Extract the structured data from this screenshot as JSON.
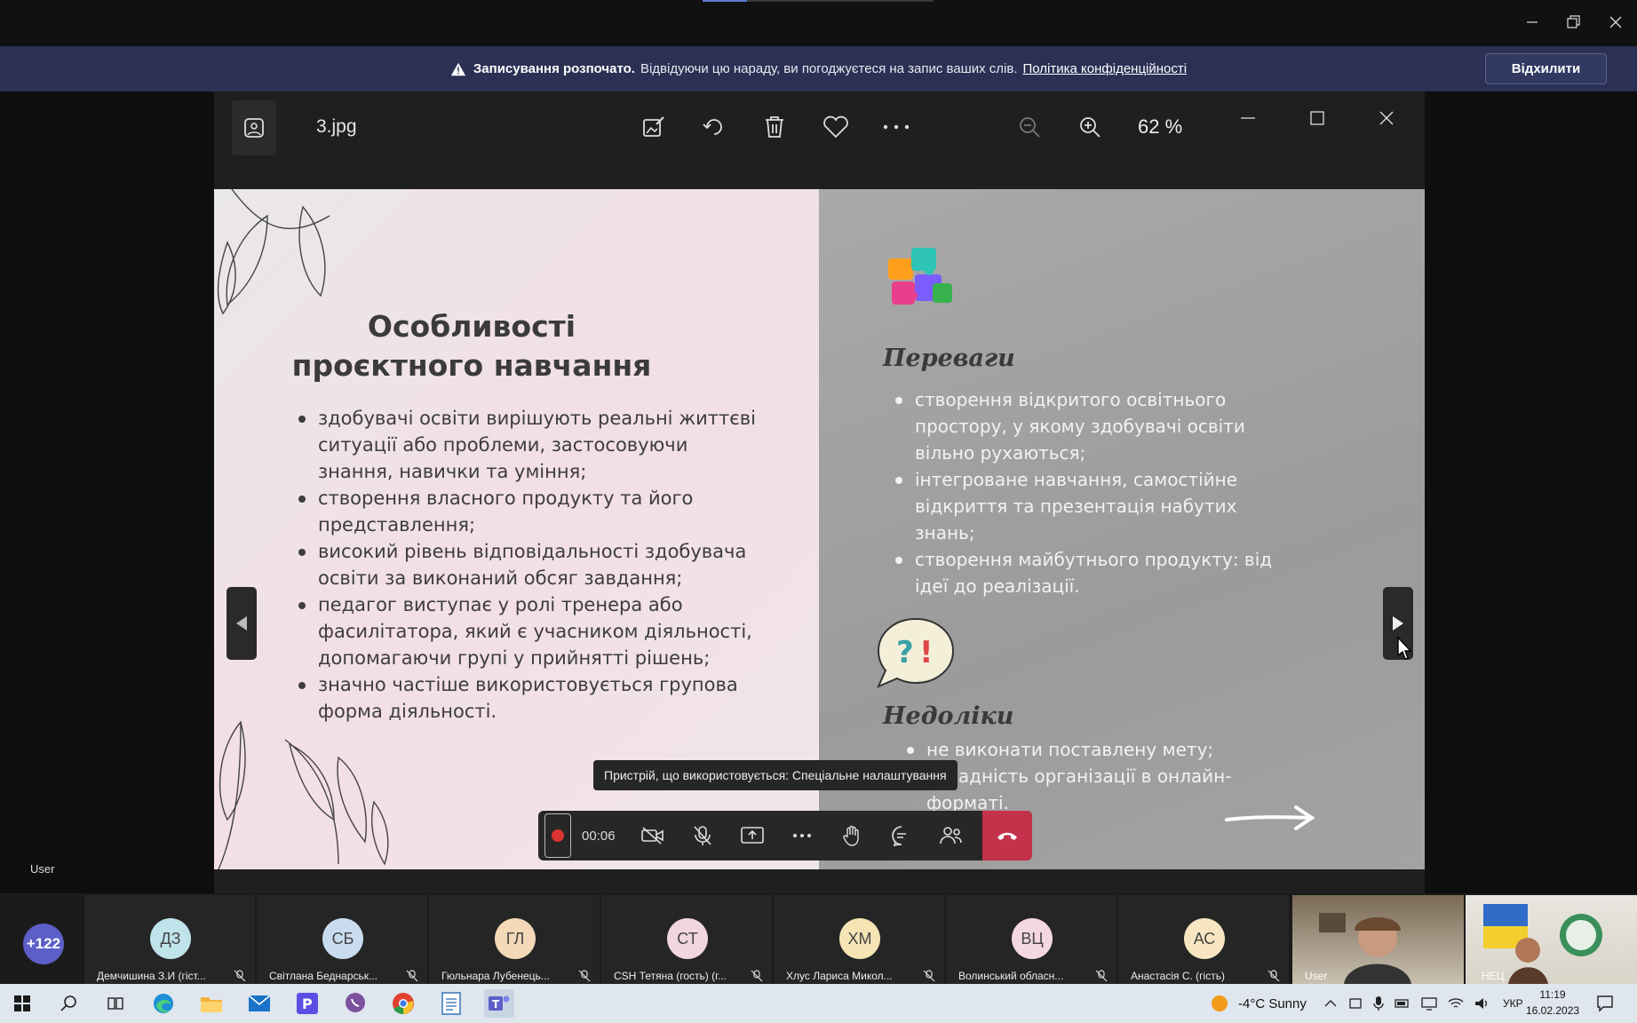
{
  "window": {
    "minimize": "—",
    "restore": "❐",
    "close": "✕"
  },
  "banner": {
    "bold": "Записування розпочато.",
    "text": "Відвідуючи цю нараду, ви погоджуєтеся на запис ваших слів.",
    "link": "Політика конфіденційності",
    "dismiss": "Відхилити"
  },
  "photos": {
    "filename": "3.jpg",
    "zoom": "62 %",
    "icons": [
      "image-icon",
      "edit-image-icon",
      "rotate-icon",
      "delete-icon",
      "favorite-icon",
      "more-icon",
      "zoom-out-icon",
      "zoom-in-icon"
    ]
  },
  "slide": {
    "title": "Особливості проєктного навчання",
    "left_items": [
      "здобувачі освіти вирішують реальні життєві ситуації або проблеми, застосовуючи знання, навички та уміння;",
      "створення власного продукту та його представлення;",
      "високий рівень відповідальності здобувача освіти за виконаний обсяг завдання;",
      "педагог виступає у ролі тренера або фасилітатора, який є учасником діяльності, допомагаючи групі у прийнятті рішень;",
      "значно частіше використовується групова форма діяльності."
    ],
    "adv_title": "Переваги",
    "adv_items": [
      "створення відкритого освітнього простору, у якому здобувачі освіти вільно рухаються;",
      "інтегроване навчання, самостійне відкриття та презентація набутих знань;",
      "створення майбутнього продукту: від ідеї до реалізації."
    ],
    "dis_title": "Недоліки",
    "dis_items": [
      "не виконати поставлену мету;",
      "складність організації в онлайн-форматі."
    ]
  },
  "tooltip": "Пристрій, що використовується: Спеціальне налаштування",
  "controls": {
    "timer": "00:06"
  },
  "self_label": "User",
  "participants": {
    "more": "+122",
    "list": [
      {
        "initials": "ДЗ",
        "name": "Демчишина З.И (гіст...",
        "color": "#bfe3ea"
      },
      {
        "initials": "СБ",
        "name": "Світлана Беднарськ...",
        "color": "#c9dcef"
      },
      {
        "initials": "ГЛ",
        "name": "Гюльнара Лубенець...",
        "color": "#f3d9b8"
      },
      {
        "initials": "СТ",
        "name": "CSH Тетяна (гость) (г...",
        "color": "#f1d6de"
      },
      {
        "initials": "ХМ",
        "name": "Хлус Лариса Микол...",
        "color": "#f6e4b5"
      },
      {
        "initials": "ВЦ",
        "name": "Волинський обласн...",
        "color": "#f4d7e2"
      },
      {
        "initials": "АС",
        "name": "Анастасія С. (гість)",
        "color": "#f7e6c1"
      }
    ],
    "video1": "User",
    "video2": "НЕЦ"
  },
  "taskbar": {
    "weather": "-4°C  Sunny",
    "lang": "УКР",
    "time": "11:19",
    "date": "16.02.2023"
  },
  "colors": {
    "banner": "#2b3154",
    "hangup": "#c4314b",
    "accent": "#5b5fc7"
  }
}
